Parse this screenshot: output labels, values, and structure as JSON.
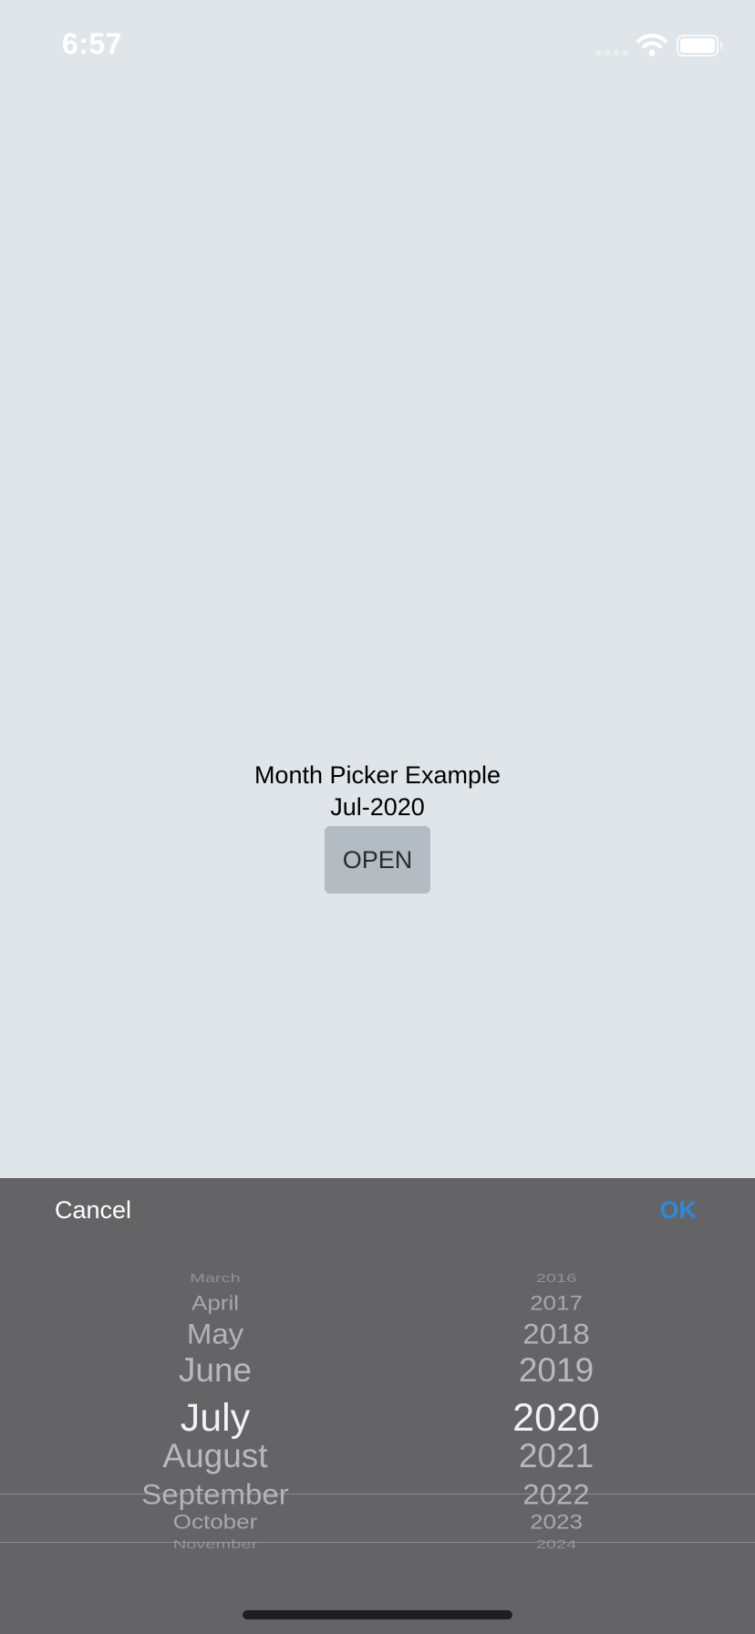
{
  "status_bar": {
    "time": "6:57"
  },
  "main": {
    "title": "Month Picker Example",
    "selected_value": "Jul-2020",
    "open_label": "OPEN"
  },
  "picker": {
    "cancel_label": "Cancel",
    "ok_label": "OK",
    "months": [
      "March",
      "April",
      "May",
      "June",
      "July",
      "August",
      "September",
      "October",
      "November"
    ],
    "years": [
      "2016",
      "2017",
      "2018",
      "2019",
      "2020",
      "2021",
      "2022",
      "2023",
      "2024"
    ],
    "selected_month": "July",
    "selected_year": "2020"
  },
  "colors": {
    "background": "#dfe5e8",
    "sheet": "#646466",
    "button": "#b2bcc2",
    "accent": "#2f88d8"
  },
  "icons": [
    "signal-icon",
    "wifi-icon",
    "battery-icon"
  ]
}
